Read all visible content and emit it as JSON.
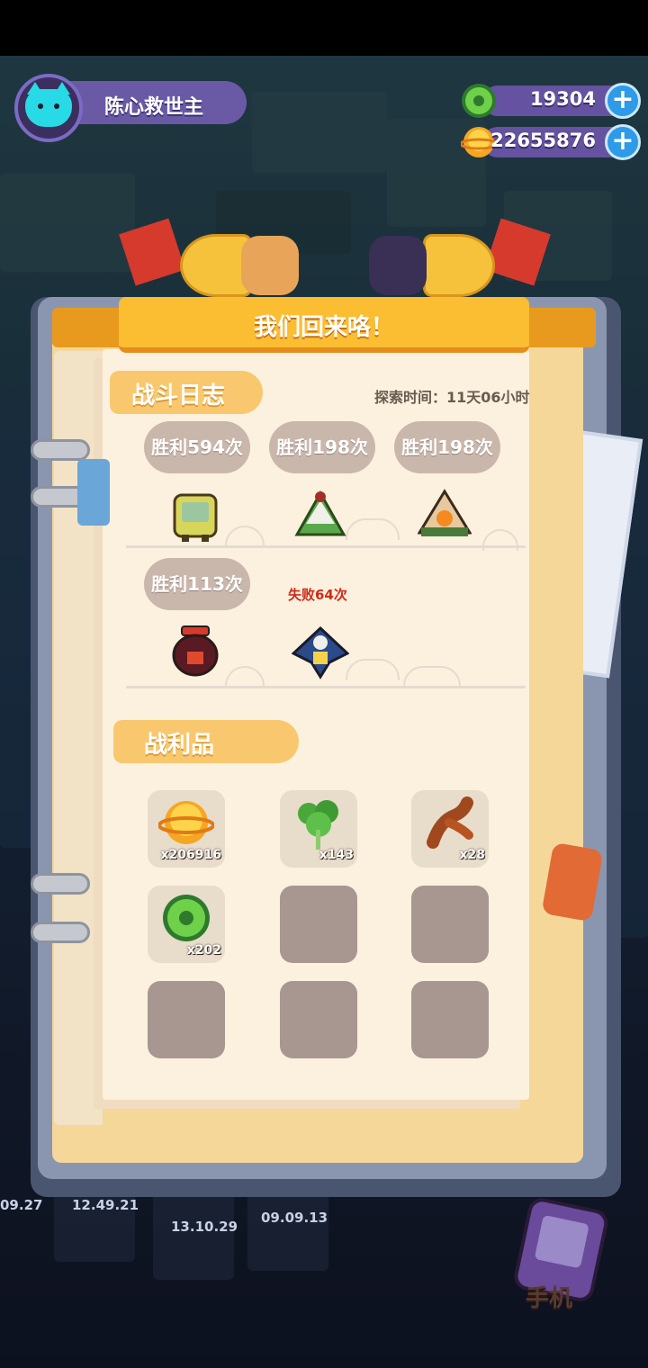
{
  "player": {
    "name": "陈心救世主",
    "avatar_icon": "cat-face-icon"
  },
  "resources": [
    {
      "icon": "green-coin-icon",
      "value": "19304"
    },
    {
      "icon": "gold-planet-coin-icon",
      "value": "22655876"
    }
  ],
  "modal": {
    "title": "我们回来咯！",
    "battle_log": {
      "heading": "战斗日志",
      "exploration_time": "探索时间：11天06小时",
      "records": [
        {
          "label": "胜利594次",
          "enemy_icon": "sponge-cake-enemy-icon"
        },
        {
          "label": "胜利198次",
          "enemy_icon": "zongzi-enemy-icon"
        },
        {
          "label": "胜利198次",
          "enemy_icon": "rice-dumpling-enemy-icon"
        },
        {
          "label": "胜利113次",
          "enemy_icon": "wine-jar-enemy-icon"
        },
        {
          "label": "失败64次",
          "enemy_icon": "kite-bird-enemy-icon"
        }
      ]
    },
    "loot": {
      "heading": "战利品",
      "items": [
        {
          "icon": "gold-planet-coin-icon",
          "count": "x206916"
        },
        {
          "icon": "cilantro-icon",
          "count": "x143"
        },
        {
          "icon": "sausage-icon",
          "count": "x28"
        },
        {
          "icon": "green-coin-icon",
          "count": "x202"
        }
      ],
      "empty_slots": 5
    }
  },
  "background": {
    "timers": [
      "09.27",
      "12.49.21",
      "13.10.29",
      "09.09.13"
    ],
    "phone_label": "手机"
  }
}
